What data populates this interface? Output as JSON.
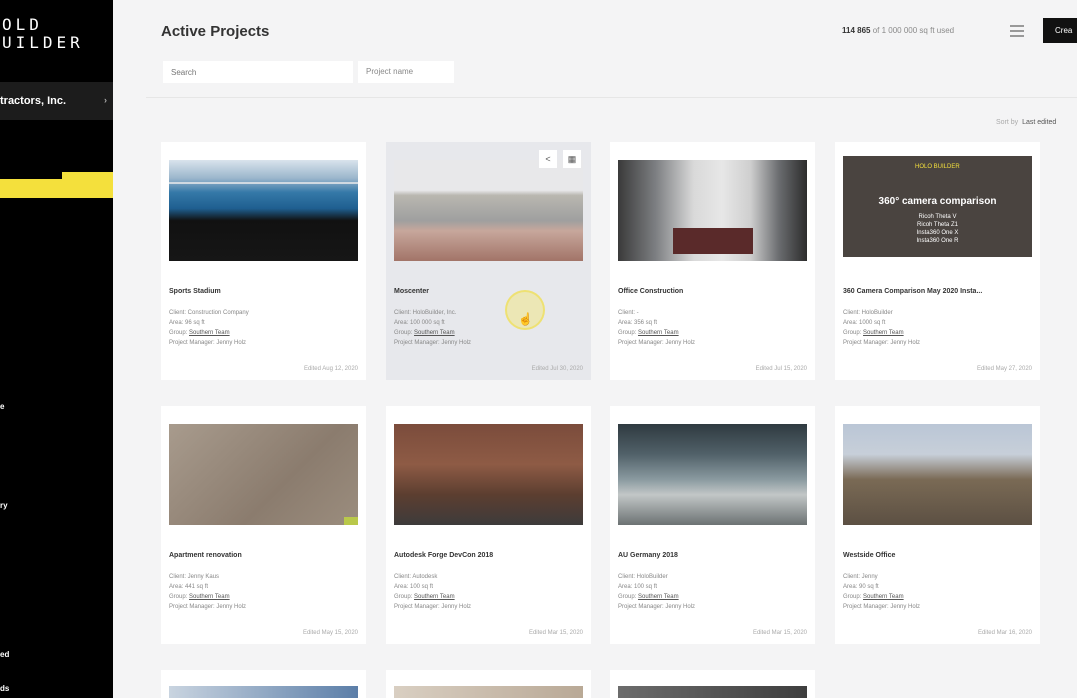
{
  "app": {
    "logo": "OLD\nUILDER",
    "company": "tractors, Inc.",
    "sidebar_items": [
      "e",
      "ry",
      "ed",
      "ds"
    ]
  },
  "header": {
    "title": "Active Projects",
    "usage_used": "114 865",
    "usage_rest": "of 1 000 000 sq ft used",
    "create_label": "Crea",
    "search_placeholder": "Search",
    "filter_label": "Project name",
    "sort_label": "Sort by",
    "sort_value": "Last edited"
  },
  "projects": [
    {
      "name": "Sports Stadium",
      "client": "Client: Construction Company",
      "area": "Area: 96 sq ft",
      "group_label": "Group: ",
      "group": "Southern Team",
      "manager": "Project Manager: Jenny Holz",
      "edited": "Edited Aug 12, 2020"
    },
    {
      "name": "Moscenter",
      "client": "Client: HoloBuilder, Inc.",
      "area": "Area: 100 000 sq ft",
      "group_label": "Group: ",
      "group": "Southern Team",
      "manager": "Project Manager: Jenny Holz",
      "edited": "Edited Jul 30, 2020"
    },
    {
      "name": "Office Construction",
      "client": "Client: -",
      "area": "Area: 356 sq ft",
      "group_label": "Group: ",
      "group": "Southern Team",
      "manager": "Project Manager: Jenny Holz",
      "edited": "Edited Jul 15, 2020"
    },
    {
      "name": "360 Camera Comparison May 2020 Insta...",
      "client": "Client: HoloBuilder",
      "area": "Area: 1000 sq ft",
      "group_label": "Group: ",
      "group": "Southern Team",
      "manager": "Project Manager: Jenny Holz",
      "edited": "Edited May 27, 2020"
    },
    {
      "name": "Apartment renovation",
      "client": "Client: Jenny Kaus",
      "area": "Area: 441 sq ft",
      "group_label": "Group: ",
      "group": "Southern Team",
      "manager": "Project Manager: Jenny Holz",
      "edited": "Edited May 15, 2020"
    },
    {
      "name": "Autodesk Forge DevCon 2018",
      "client": "Client: Autodesk",
      "area": "Area: 100 sq ft",
      "group_label": "Group: ",
      "group": "Southern Team",
      "manager": "Project Manager: Jenny Holz",
      "edited": "Edited Mar 15, 2020"
    },
    {
      "name": "AU Germany 2018",
      "client": "Client: HoloBuilder",
      "area": "Area: 100 sq ft",
      "group_label": "Group: ",
      "group": "Southern Team",
      "manager": "Project Manager: Jenny Holz",
      "edited": "Edited Mar 15, 2020"
    },
    {
      "name": "Westside Office",
      "client": "Client: Jenny",
      "area": "Area: 90 sq ft",
      "group_label": "Group: ",
      "group": "Southern Team",
      "manager": "Project Manager: Jenny Holz",
      "edited": "Edited Mar 16, 2020"
    }
  ],
  "overlay360": {
    "brand": "HOLO BUILDER",
    "title": "360° camera comparison",
    "lines": [
      "Ricoh Theta V",
      "Ricoh Theta Z1",
      "Insta360 One X",
      "Insta360 One R"
    ]
  },
  "colors": {
    "accent": "#f4e03c",
    "sidebar": "#000000",
    "background": "#f4f4f5"
  },
  "icons": {
    "share": "share-icon",
    "calendar": "calendar-icon",
    "menu": "menu-icon",
    "cursor": "hand-cursor-icon"
  }
}
